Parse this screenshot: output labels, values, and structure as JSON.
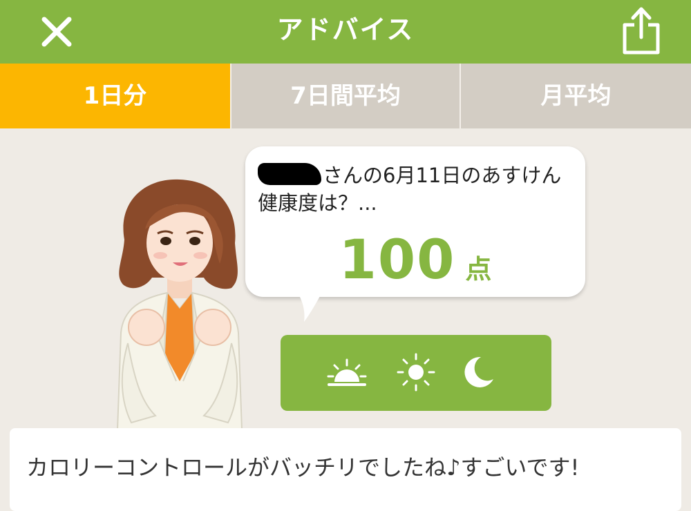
{
  "header": {
    "title": "アドバイス",
    "close_icon": "close-icon",
    "share_icon": "share-icon"
  },
  "tabs": [
    {
      "label": "1日分",
      "active": true
    },
    {
      "label": "7日間平均",
      "active": false
    },
    {
      "label": "月平均",
      "active": false
    }
  ],
  "bubble": {
    "greeting_line1": "さんの6月11日のあすけん",
    "greeting_line2": "健康度は？...",
    "score_value": "100",
    "score_unit": "点"
  },
  "time_of_day": {
    "icons": [
      "sunrise-icon",
      "sun-icon",
      "moon-icon"
    ]
  },
  "message": {
    "text": "カロリーコントロールがバッチリでしたね♪すごいです!"
  },
  "colors": {
    "brand_green": "#86b641",
    "active_tab": "#fcb601",
    "inactive_tab": "#d3cdc4",
    "background": "#efebe5"
  }
}
